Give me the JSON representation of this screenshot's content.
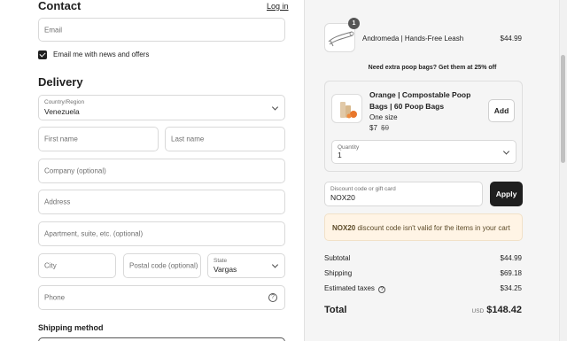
{
  "contact": {
    "title": "Contact",
    "login_link": "Log in",
    "email_placeholder": "Email",
    "newsletter_label": "Email me with news and offers"
  },
  "delivery": {
    "title": "Delivery",
    "country_label": "Country/Region",
    "country_value": "Venezuela",
    "first_name_placeholder": "First name",
    "last_name_placeholder": "Last name",
    "company_placeholder": "Company (optional)",
    "address_placeholder": "Address",
    "apartment_placeholder": "Apartment, suite, etc. (optional)",
    "city_placeholder": "City",
    "postal_placeholder": "Postal code (optional)",
    "state_label": "State",
    "state_value": "Vargas",
    "phone_placeholder": "Phone",
    "help_glyph": "?"
  },
  "shipping_method": {
    "title": "Shipping method"
  },
  "cart": {
    "item": {
      "quantity_badge": "1",
      "name": "Andromeda | Hands-Free Leash",
      "price": "$44.99"
    },
    "upsell": {
      "heading": "Need extra poop bags? Get them at 25% off",
      "name_line1": "Orange | Compostable Poop",
      "name_line2": "Bags | 60 Poop Bags",
      "variant": "One size",
      "price": "$7",
      "compare_price": "$9",
      "add_button": "Add",
      "quantity_label": "Quantity",
      "quantity_value": "1"
    },
    "discount": {
      "label": "Discount code or gift card",
      "value": "NOX20",
      "apply_button": "Apply",
      "warning_code": "NOX20",
      "warning_text": " discount code isn't valid for the items in your cart"
    },
    "summary": {
      "subtotal_label": "Subtotal",
      "subtotal_value": "$44.99",
      "shipping_label": "Shipping",
      "shipping_value": "$69.18",
      "taxes_label": "Estimated taxes",
      "taxes_info": "?",
      "taxes_value": "$34.25",
      "total_label": "Total",
      "currency": "USD",
      "total_value": "$148.42"
    }
  },
  "colors": {
    "accent_dark": "#1f1f1f",
    "warning_bg": "#fff4e5",
    "summary_bg": "#f5f5f5"
  }
}
